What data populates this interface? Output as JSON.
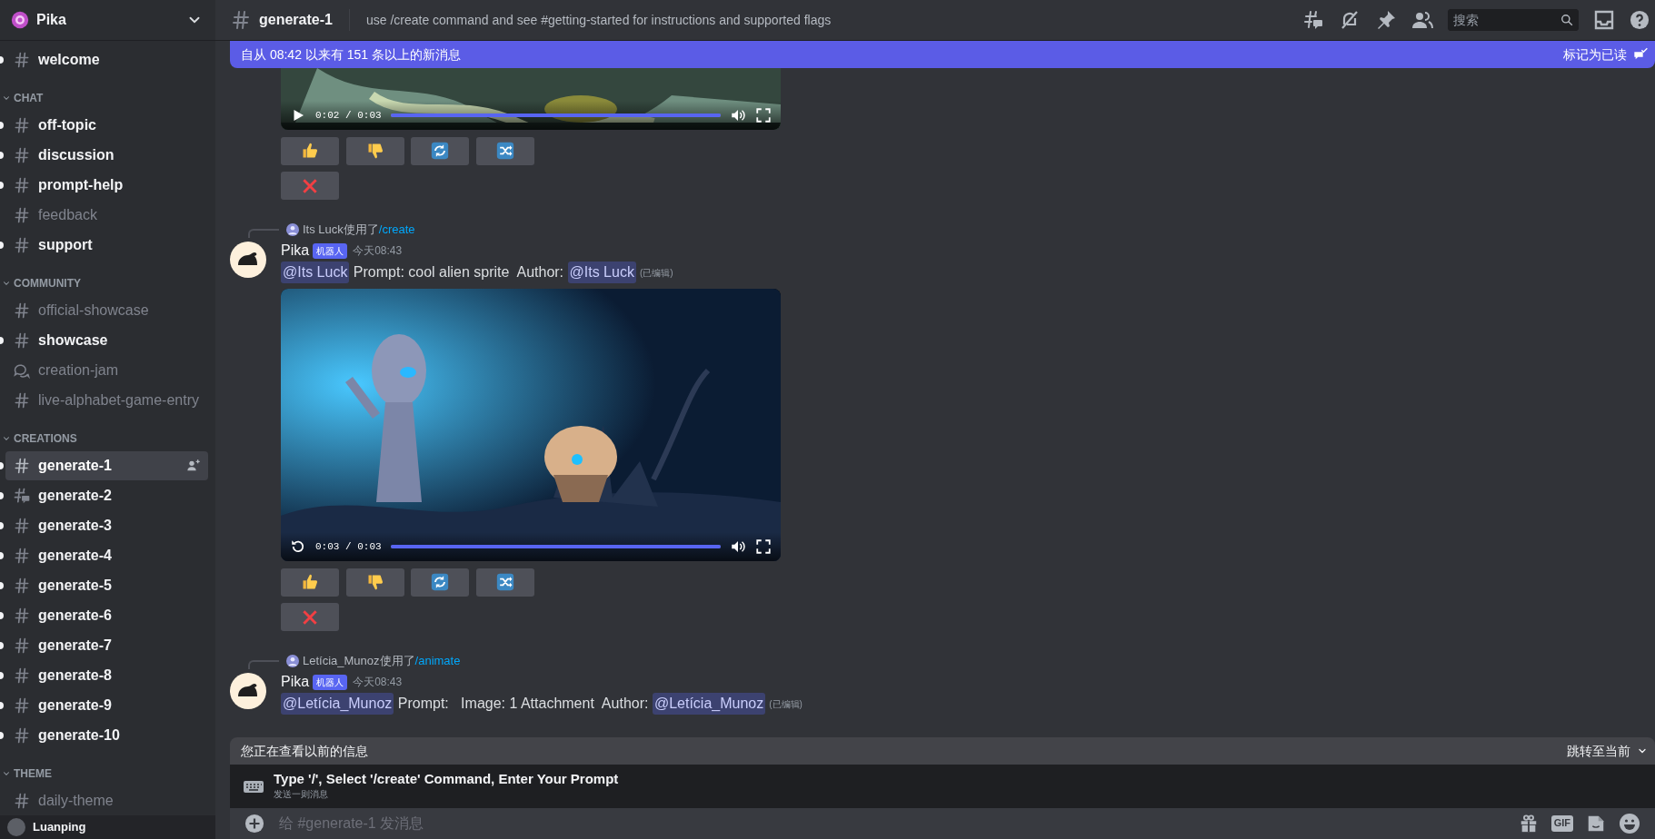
{
  "server": {
    "name": "Pika"
  },
  "sidebar": {
    "top_channel": {
      "name": "welcome",
      "unread": true,
      "selected": false,
      "kind": "text"
    },
    "categories": [
      {
        "name": "CHAT",
        "expanded": true,
        "channels": [
          {
            "name": "off-topic",
            "unread": true,
            "selected": false,
            "kind": "text"
          },
          {
            "name": "discussion",
            "unread": true,
            "selected": false,
            "kind": "text"
          },
          {
            "name": "prompt-help",
            "unread": true,
            "selected": false,
            "kind": "text"
          },
          {
            "name": "feedback",
            "unread": false,
            "selected": false,
            "kind": "text"
          },
          {
            "name": "support",
            "unread": true,
            "selected": false,
            "kind": "text"
          }
        ]
      },
      {
        "name": "COMMUNITY",
        "expanded": true,
        "channels": [
          {
            "name": "official-showcase",
            "unread": false,
            "selected": false,
            "kind": "text"
          },
          {
            "name": "showcase",
            "unread": true,
            "selected": false,
            "kind": "text"
          },
          {
            "name": "creation-jam",
            "unread": false,
            "selected": false,
            "kind": "forum"
          },
          {
            "name": "live-alphabet-game-entry",
            "unread": false,
            "selected": false,
            "kind": "text"
          }
        ]
      },
      {
        "name": "CREATIONS",
        "expanded": true,
        "channels": [
          {
            "name": "generate-1",
            "unread": true,
            "selected": true,
            "kind": "text"
          },
          {
            "name": "generate-2",
            "unread": true,
            "selected": false,
            "kind": "threads"
          },
          {
            "name": "generate-3",
            "unread": true,
            "selected": false,
            "kind": "text"
          },
          {
            "name": "generate-4",
            "unread": true,
            "selected": false,
            "kind": "text"
          },
          {
            "name": "generate-5",
            "unread": true,
            "selected": false,
            "kind": "text"
          },
          {
            "name": "generate-6",
            "unread": true,
            "selected": false,
            "kind": "text"
          },
          {
            "name": "generate-7",
            "unread": true,
            "selected": false,
            "kind": "text"
          },
          {
            "name": "generate-8",
            "unread": true,
            "selected": false,
            "kind": "text"
          },
          {
            "name": "generate-9",
            "unread": true,
            "selected": false,
            "kind": "text"
          },
          {
            "name": "generate-10",
            "unread": true,
            "selected": false,
            "kind": "text"
          }
        ]
      },
      {
        "name": "THEME",
        "expanded": true,
        "channels": [
          {
            "name": "daily-theme",
            "unread": false,
            "selected": false,
            "kind": "text"
          }
        ]
      }
    ],
    "user_panel": {
      "name": "Luanping"
    }
  },
  "header": {
    "channel": "generate-1",
    "topic": "use /create command and see #getting-started for instructions and supported flags",
    "search": {
      "placeholder": "搜索"
    }
  },
  "new_messages_banner": {
    "text": "自从 08:42 以来有 151 条以上的新消息",
    "action": "标记为已读"
  },
  "messages": [
    {
      "kind": "video_tail",
      "video": {
        "kind": "paused_player",
        "time": "0:02 / 0:03",
        "level": 1
      }
    },
    {
      "kind": "bot",
      "reply": {
        "text": "Its Luck使用了",
        "command": "/create"
      },
      "author": "Pika",
      "badge": "机器人",
      "time": "今天08:43",
      "content": [
        {
          "kind": "mention",
          "text": "@Its Luck"
        },
        {
          "kind": "text",
          "text": " Prompt: cool alien sprite  Author: "
        },
        {
          "kind": "mention",
          "text": "@Its Luck"
        }
      ],
      "edited": "(已编辑)",
      "video": {
        "kind": "ended_player",
        "time": "0:03 / 0:03",
        "level": 1
      }
    },
    {
      "kind": "bot",
      "reply": {
        "text": "Letícia_Munoz使用了",
        "command": "/animate"
      },
      "author": "Pika",
      "badge": "机器人",
      "time": "今天08:43",
      "content": [
        {
          "kind": "mention",
          "text": "@Letícia_Munoz"
        },
        {
          "kind": "text",
          "text": " Prompt:   Image: 1 Attachment  Author: "
        },
        {
          "kind": "mention",
          "text": "@Letícia_Munoz"
        }
      ],
      "edited": "(已编辑)"
    }
  ],
  "old_messages_bar": {
    "text": "您正在查看以前的信息",
    "action": "跳转至当前"
  },
  "command_hint": {
    "title": "Type '/', Select '/create' Command, Enter Your Prompt",
    "subtitle": "发送一则消息"
  },
  "composer": {
    "placeholder": "给 #generate-1 发消息",
    "gif": "GIF"
  }
}
